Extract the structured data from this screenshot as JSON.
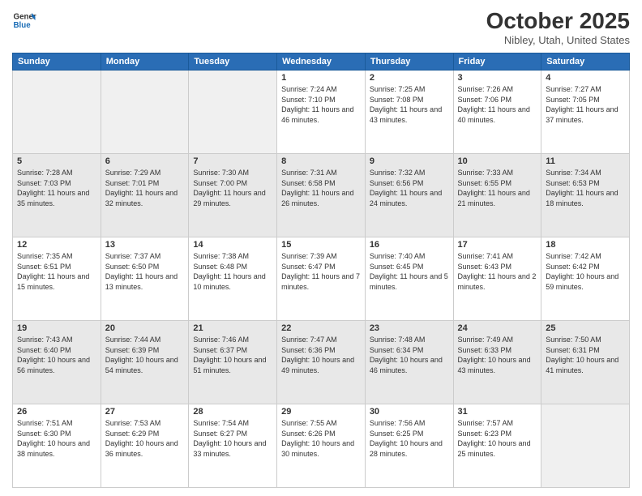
{
  "header": {
    "logo_line1": "General",
    "logo_line2": "Blue",
    "month": "October 2025",
    "location": "Nibley, Utah, United States"
  },
  "weekdays": [
    "Sunday",
    "Monday",
    "Tuesday",
    "Wednesday",
    "Thursday",
    "Friday",
    "Saturday"
  ],
  "rows": [
    [
      {
        "num": "",
        "text": "",
        "shade": "empty"
      },
      {
        "num": "",
        "text": "",
        "shade": "empty"
      },
      {
        "num": "",
        "text": "",
        "shade": "empty"
      },
      {
        "num": "1",
        "text": "Sunrise: 7:24 AM\nSunset: 7:10 PM\nDaylight: 11 hours and 46 minutes.",
        "shade": ""
      },
      {
        "num": "2",
        "text": "Sunrise: 7:25 AM\nSunset: 7:08 PM\nDaylight: 11 hours and 43 minutes.",
        "shade": ""
      },
      {
        "num": "3",
        "text": "Sunrise: 7:26 AM\nSunset: 7:06 PM\nDaylight: 11 hours and 40 minutes.",
        "shade": ""
      },
      {
        "num": "4",
        "text": "Sunrise: 7:27 AM\nSunset: 7:05 PM\nDaylight: 11 hours and 37 minutes.",
        "shade": ""
      }
    ],
    [
      {
        "num": "5",
        "text": "Sunrise: 7:28 AM\nSunset: 7:03 PM\nDaylight: 11 hours and 35 minutes.",
        "shade": "shaded"
      },
      {
        "num": "6",
        "text": "Sunrise: 7:29 AM\nSunset: 7:01 PM\nDaylight: 11 hours and 32 minutes.",
        "shade": "shaded"
      },
      {
        "num": "7",
        "text": "Sunrise: 7:30 AM\nSunset: 7:00 PM\nDaylight: 11 hours and 29 minutes.",
        "shade": "shaded"
      },
      {
        "num": "8",
        "text": "Sunrise: 7:31 AM\nSunset: 6:58 PM\nDaylight: 11 hours and 26 minutes.",
        "shade": "shaded"
      },
      {
        "num": "9",
        "text": "Sunrise: 7:32 AM\nSunset: 6:56 PM\nDaylight: 11 hours and 24 minutes.",
        "shade": "shaded"
      },
      {
        "num": "10",
        "text": "Sunrise: 7:33 AM\nSunset: 6:55 PM\nDaylight: 11 hours and 21 minutes.",
        "shade": "shaded"
      },
      {
        "num": "11",
        "text": "Sunrise: 7:34 AM\nSunset: 6:53 PM\nDaylight: 11 hours and 18 minutes.",
        "shade": "shaded"
      }
    ],
    [
      {
        "num": "12",
        "text": "Sunrise: 7:35 AM\nSunset: 6:51 PM\nDaylight: 11 hours and 15 minutes.",
        "shade": ""
      },
      {
        "num": "13",
        "text": "Sunrise: 7:37 AM\nSunset: 6:50 PM\nDaylight: 11 hours and 13 minutes.",
        "shade": ""
      },
      {
        "num": "14",
        "text": "Sunrise: 7:38 AM\nSunset: 6:48 PM\nDaylight: 11 hours and 10 minutes.",
        "shade": ""
      },
      {
        "num": "15",
        "text": "Sunrise: 7:39 AM\nSunset: 6:47 PM\nDaylight: 11 hours and 7 minutes.",
        "shade": ""
      },
      {
        "num": "16",
        "text": "Sunrise: 7:40 AM\nSunset: 6:45 PM\nDaylight: 11 hours and 5 minutes.",
        "shade": ""
      },
      {
        "num": "17",
        "text": "Sunrise: 7:41 AM\nSunset: 6:43 PM\nDaylight: 11 hours and 2 minutes.",
        "shade": ""
      },
      {
        "num": "18",
        "text": "Sunrise: 7:42 AM\nSunset: 6:42 PM\nDaylight: 10 hours and 59 minutes.",
        "shade": ""
      }
    ],
    [
      {
        "num": "19",
        "text": "Sunrise: 7:43 AM\nSunset: 6:40 PM\nDaylight: 10 hours and 56 minutes.",
        "shade": "shaded"
      },
      {
        "num": "20",
        "text": "Sunrise: 7:44 AM\nSunset: 6:39 PM\nDaylight: 10 hours and 54 minutes.",
        "shade": "shaded"
      },
      {
        "num": "21",
        "text": "Sunrise: 7:46 AM\nSunset: 6:37 PM\nDaylight: 10 hours and 51 minutes.",
        "shade": "shaded"
      },
      {
        "num": "22",
        "text": "Sunrise: 7:47 AM\nSunset: 6:36 PM\nDaylight: 10 hours and 49 minutes.",
        "shade": "shaded"
      },
      {
        "num": "23",
        "text": "Sunrise: 7:48 AM\nSunset: 6:34 PM\nDaylight: 10 hours and 46 minutes.",
        "shade": "shaded"
      },
      {
        "num": "24",
        "text": "Sunrise: 7:49 AM\nSunset: 6:33 PM\nDaylight: 10 hours and 43 minutes.",
        "shade": "shaded"
      },
      {
        "num": "25",
        "text": "Sunrise: 7:50 AM\nSunset: 6:31 PM\nDaylight: 10 hours and 41 minutes.",
        "shade": "shaded"
      }
    ],
    [
      {
        "num": "26",
        "text": "Sunrise: 7:51 AM\nSunset: 6:30 PM\nDaylight: 10 hours and 38 minutes.",
        "shade": ""
      },
      {
        "num": "27",
        "text": "Sunrise: 7:53 AM\nSunset: 6:29 PM\nDaylight: 10 hours and 36 minutes.",
        "shade": ""
      },
      {
        "num": "28",
        "text": "Sunrise: 7:54 AM\nSunset: 6:27 PM\nDaylight: 10 hours and 33 minutes.",
        "shade": ""
      },
      {
        "num": "29",
        "text": "Sunrise: 7:55 AM\nSunset: 6:26 PM\nDaylight: 10 hours and 30 minutes.",
        "shade": ""
      },
      {
        "num": "30",
        "text": "Sunrise: 7:56 AM\nSunset: 6:25 PM\nDaylight: 10 hours and 28 minutes.",
        "shade": ""
      },
      {
        "num": "31",
        "text": "Sunrise: 7:57 AM\nSunset: 6:23 PM\nDaylight: 10 hours and 25 minutes.",
        "shade": ""
      },
      {
        "num": "",
        "text": "",
        "shade": "empty"
      }
    ]
  ]
}
